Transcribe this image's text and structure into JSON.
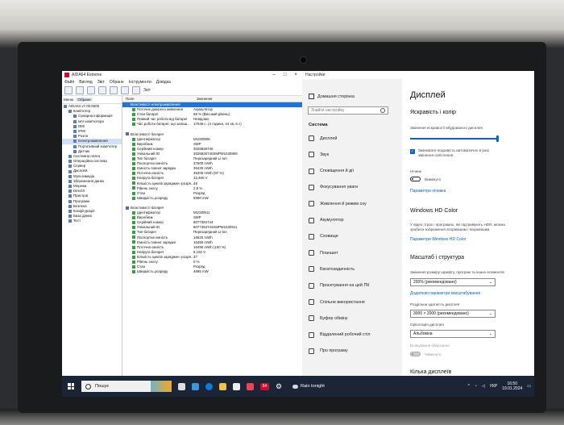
{
  "aida": {
    "title": "AIDA64 Extreme",
    "menu": [
      "Файл",
      "Вигляд",
      "Звіт",
      "Обране",
      "Інструменти",
      "Довідка"
    ],
    "toolbar_label": "Звіт",
    "tabs": [
      "Меню",
      "Обране"
    ],
    "tree": [
      {
        "label": "AIDA64 v7.00.6600",
        "sel": false,
        "indent": 0
      },
      {
        "label": "Комп'ютер",
        "sel": false,
        "indent": 1
      },
      {
        "label": "Сумарна інформація",
        "sel": false,
        "indent": 2
      },
      {
        "label": "Ім'я комп'ютера",
        "sel": false,
        "indent": 2
      },
      {
        "label": "DMI",
        "sel": false,
        "indent": 2
      },
      {
        "label": "IPMI",
        "sel": false,
        "indent": 2
      },
      {
        "label": "Розгін",
        "sel": false,
        "indent": 2
      },
      {
        "label": "Електроживлення",
        "sel": true,
        "indent": 2
      },
      {
        "label": "Портативний комп'ютер",
        "sel": false,
        "indent": 2
      },
      {
        "label": "Датчик",
        "sel": false,
        "indent": 2
      },
      {
        "label": "Системна плата",
        "sel": false,
        "indent": 1
      },
      {
        "label": "Операційна система",
        "sel": false,
        "indent": 1
      },
      {
        "label": "Сервер",
        "sel": false,
        "indent": 1
      },
      {
        "label": "Дисплей",
        "sel": false,
        "indent": 1
      },
      {
        "label": "Мультимедіа",
        "sel": false,
        "indent": 1
      },
      {
        "label": "Збереження даних",
        "sel": false,
        "indent": 1
      },
      {
        "label": "Мережа",
        "sel": false,
        "indent": 1
      },
      {
        "label": "DirectX",
        "sel": false,
        "indent": 1
      },
      {
        "label": "Пристрої",
        "sel": false,
        "indent": 1
      },
      {
        "label": "Програми",
        "sel": false,
        "indent": 1
      },
      {
        "label": "Безпека",
        "sel": false,
        "indent": 1
      },
      {
        "label": "Конфігурація",
        "sel": false,
        "indent": 1
      },
      {
        "label": "База даних",
        "sel": false,
        "indent": 1
      },
      {
        "label": "Тест",
        "sel": false,
        "indent": 1
      }
    ],
    "col_field": "Поле",
    "col_value": "Значення",
    "rows": [
      {
        "f": "Властивості електроживлення",
        "v": "",
        "sec": true,
        "hl": true
      },
      {
        "f": "Поточне джерело живлення",
        "v": "Акумулятор"
      },
      {
        "f": "Стан батареї",
        "v": "58 % (Високий рівень)"
      },
      {
        "f": "Повний час роботи від батареї",
        "v": "Невідомо"
      },
      {
        "f": "Час роботи батареї, що залиш...",
        "v": "17046 с. (4 година, 44 хв, 6 с)"
      },
      {
        "f": "",
        "v": ""
      },
      {
        "f": "Властивості батареї",
        "v": "",
        "sec": true
      },
      {
        "f": "Ідентифікатор",
        "v": "M1030906"
      },
      {
        "f": "Виробник",
        "v": "SMP"
      },
      {
        "f": "Серійний номер",
        "v": "3026826740"
      },
      {
        "f": "Унікальний ID",
        "v": "3026826740SMPM1030906"
      },
      {
        "f": "Тип батареї",
        "v": "Перезарядний Li-Ion"
      },
      {
        "f": "Паспортна ємність",
        "v": "37500 mWh"
      },
      {
        "f": "Ємність повної зарядки",
        "v": "36430 mWh"
      },
      {
        "f": "Поточна ємність",
        "v": "35400 mWh (97 %)"
      },
      {
        "f": "Напруга батареї",
        "v": "12,460 V"
      },
      {
        "f": "Кількість циклів заряджен.-розря...",
        "v": "48"
      },
      {
        "f": "Рівень зносу",
        "v": "2,9 %"
      },
      {
        "f": "Стан",
        "v": "Розряд"
      },
      {
        "f": "Швидкість розряду",
        "v": "5590 mW"
      },
      {
        "f": "",
        "v": ""
      },
      {
        "f": "Властивості батареї",
        "v": "",
        "sec": true
      },
      {
        "f": "Ідентифікатор",
        "v": "M1030911"
      },
      {
        "f": "Виробник",
        "v": "SMP"
      },
      {
        "f": "Серійний номер",
        "v": "8077384744"
      },
      {
        "f": "Унікальний ID",
        "v": "8077384744SMPM1030911"
      },
      {
        "f": "Тип батареї",
        "v": "Перезарядний Li-Ion"
      },
      {
        "f": "Паспортна ємність",
        "v": "16620 mWh"
      },
      {
        "f": "Ємність повної зарядки",
        "v": "16490 mWh"
      },
      {
        "f": "Поточна ємність",
        "v": "16490 mWh (100 %)"
      },
      {
        "f": "Напруга батареї",
        "v": "8,192 V"
      },
      {
        "f": "Кількість циклів заряджен.-розря...",
        "v": "37"
      },
      {
        "f": "Рівень зносу",
        "v": "0 %"
      },
      {
        "f": "Стан",
        "v": "Розряд"
      },
      {
        "f": "Швидкість розряду",
        "v": "4695 mW"
      }
    ]
  },
  "settings": {
    "title": "Настройки",
    "home": "Домашня сторінка",
    "search_placeholder": "Знайти настройку",
    "section": "Система",
    "nav": [
      "Дисплей",
      "Звук",
      "Сповіщення й дії",
      "Фокусування уваги",
      "Живлення й режим сну",
      "Акумулятор",
      "Сховище",
      "Планшет",
      "Багатозадачність",
      "Проєктування на цей ПК",
      "Спільне використання",
      "Буфер обміну",
      "Віддалений робочий стіл",
      "Про програму"
    ],
    "heading": "Дисплей",
    "brightness_title": "Яскравість і колір",
    "brightness_label": "Змінення яскравості вбудованого дисплея",
    "brightness_level": 100,
    "auto_brightness": "Змінювати яскравість автоматично в разі змінення освітлення",
    "night_label": "Нічник",
    "night_state": "Вимкнуто",
    "night_link": "Параметри нічника",
    "hd_title": "Windows HD Color",
    "hd_text": "У відео, іграх і програмах, які підтримують HDR, можна зробити зображення яскравішим і яскравішим.",
    "hd_link": "Параметри Windows HD Color",
    "scale_title": "Масштаб і структура",
    "scale_label": "Змінення розміру шрифту, програм та інших елементів",
    "scale_value": "200% (рекомендовано)",
    "scale_link": "Додаткові параметри масштабування",
    "res_label": "Роздільна здатність дисплея",
    "res_value": "3000 × 2000 (рекомендовано)",
    "orient_label": "Орієнтація дисплея",
    "orient_value": "Альбомна",
    "lock_label": "Блокування обертання",
    "lock_state": "Увімкнуто",
    "multi_title": "Кілька дисплеїв"
  },
  "taskbar": {
    "search": "Пошук",
    "weather": "Rain tonight",
    "lang": "УКР",
    "time": "16:50",
    "date": "19.01.2024"
  }
}
